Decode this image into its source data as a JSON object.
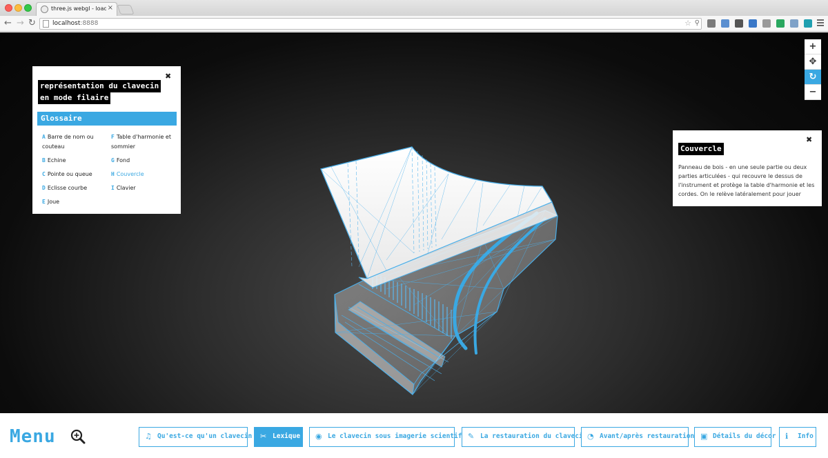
{
  "browser": {
    "tab_title": "three.js webgl - loaders - C",
    "tab_close": "×",
    "url_host": "localhost",
    "url_port": ":8888",
    "extensions": [
      {
        "icon": "download-icon",
        "color": "#7b7b7b"
      },
      {
        "icon": "note-icon",
        "color": "#5b8fd0"
      },
      {
        "icon": "shield-icon",
        "color": "#555555"
      },
      {
        "icon": "c-icon",
        "color": "#3a78c8"
      },
      {
        "icon": "abp-icon",
        "color": "#9a9a9a"
      },
      {
        "icon": "y-icon",
        "color": "#2aa860"
      },
      {
        "icon": "image-icon",
        "color": "#7fa2c8"
      },
      {
        "icon": "c2-icon",
        "color": "#1f9fb0"
      }
    ]
  },
  "map_controls": {
    "zoom_in": "+",
    "pan": "✥",
    "reset": "↻",
    "zoom_out": "−"
  },
  "glossary_panel": {
    "title_line1": "représentation du clavecin",
    "title_line2": "en mode filaire",
    "close": "✖",
    "header": "Glossaire",
    "items": [
      {
        "key": "A",
        "label": "Barre de nom ou couteau"
      },
      {
        "key": "B",
        "label": "Echine"
      },
      {
        "key": "C",
        "label": "Pointe ou queue"
      },
      {
        "key": "D",
        "label": "Eclisse courbe"
      },
      {
        "key": "E",
        "label": "Joue"
      },
      {
        "key": "F",
        "label": "Table d'harmonie et sommier"
      },
      {
        "key": "G",
        "label": "Fond"
      },
      {
        "key": "H",
        "label": "Couvercle"
      },
      {
        "key": "I",
        "label": "Clavier"
      }
    ],
    "active_key": "H"
  },
  "info_panel": {
    "title": "Couvercle",
    "close": "✖",
    "text": "Panneau de bois - en une seule partie ou deux parties articulées - qui recouvre le dessus de l'instrument et protège la table d'harmonie et les cordes. On le relève latéralement pour jouer"
  },
  "bottom_menu": {
    "logo": "Menu",
    "items": [
      {
        "label": "Qu'est-ce qu'un clavecin ?",
        "icon": "♫",
        "icon_name": "music-note-icon",
        "active": false
      },
      {
        "label": "Lexique",
        "icon": "✂",
        "icon_name": "tools-icon",
        "active": true
      },
      {
        "label": "Le clavecin sous imagerie scientifique",
        "icon": "◉",
        "icon_name": "eye-icon",
        "active": false
      },
      {
        "label": "La restauration du clavecin",
        "icon": "✎",
        "icon_name": "brush-icon",
        "active": false
      },
      {
        "label": "Avant/après restauration",
        "icon": "◔",
        "icon_name": "gauge-icon",
        "active": false
      },
      {
        "label": "Détails du décor",
        "icon": "▣",
        "icon_name": "picture-icon",
        "active": false
      },
      {
        "label": "Info",
        "icon": "ℹ",
        "icon_name": "info-icon",
        "active": false
      }
    ]
  },
  "colors": {
    "accent": "#3aa8e2",
    "wireframe": "#4aaee8"
  }
}
